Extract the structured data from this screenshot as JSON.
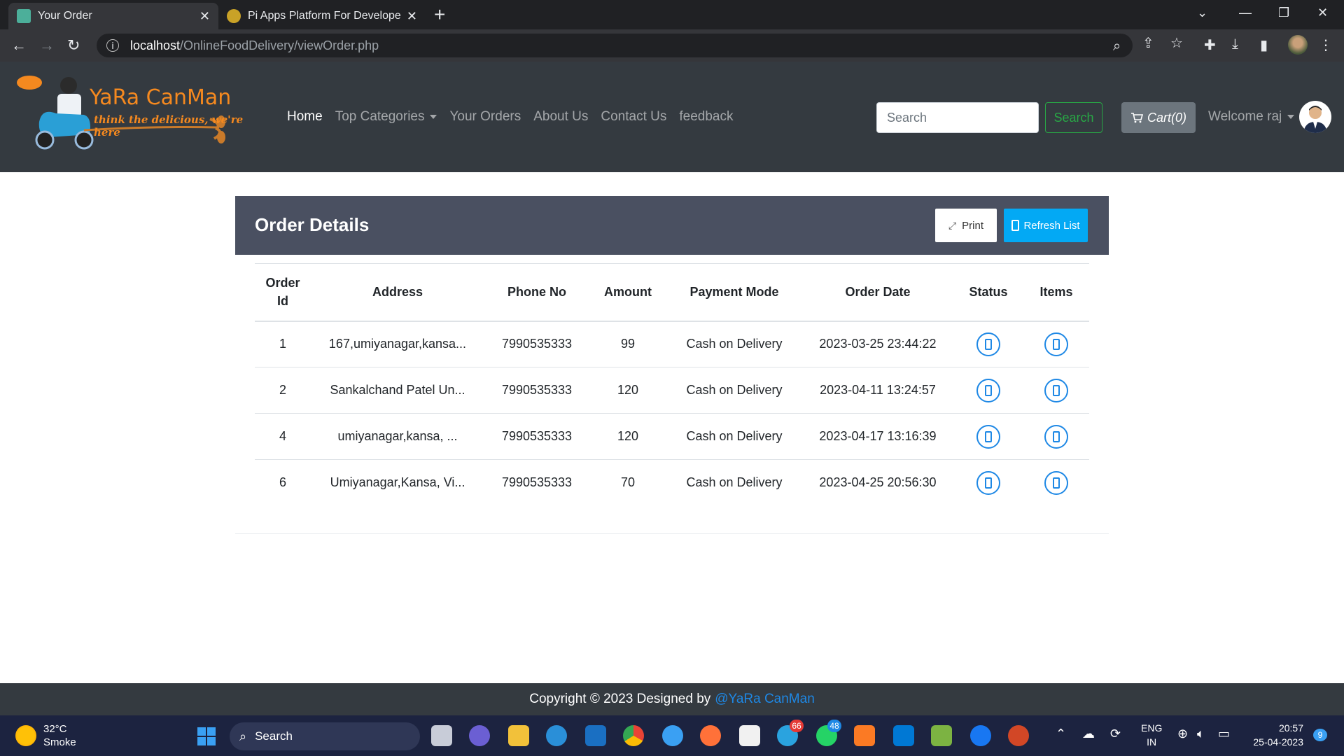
{
  "browser": {
    "tabs": [
      {
        "title": "Your Order",
        "active": true
      },
      {
        "title": "Pi Apps Platform For Developers",
        "active": false
      }
    ],
    "url_host": "localhost",
    "url_path": "/OnlineFoodDelivery/viewOrder.php"
  },
  "site": {
    "brand": "YaRa CanMan",
    "tagline": "think the delicious, we're here",
    "nav": [
      "Home",
      "Top Categories",
      "Your Orders",
      "About Us",
      "Contact Us",
      "feedback"
    ],
    "search_placeholder": "Search",
    "search_button": "Search",
    "cart_label": "Cart(0)",
    "welcome": "Welcome raj"
  },
  "order_panel": {
    "title": "Order Details",
    "print_label": "Print",
    "refresh_label": "Refresh List",
    "headers": [
      "Order Id",
      "Address",
      "Phone No",
      "Amount",
      "Payment Mode",
      "Order Date",
      "Status",
      "Items"
    ],
    "rows": [
      {
        "id": "1",
        "address": "167,umiyanagar,kansa...",
        "phone": "7990535333",
        "amount": "99",
        "payment": "Cash on Delivery",
        "date": "2023-03-25 23:44:22"
      },
      {
        "id": "2",
        "address": "Sankalchand Patel Un...",
        "phone": "7990535333",
        "amount": "120",
        "payment": "Cash on Delivery",
        "date": "2023-04-11 13:24:57"
      },
      {
        "id": "4",
        "address": "umiyanagar,kansa, ...",
        "phone": "7990535333",
        "amount": "120",
        "payment": "Cash on Delivery",
        "date": "2023-04-17 13:16:39"
      },
      {
        "id": "6",
        "address": "Umiyanagar,Kansa, Vi...",
        "phone": "7990535333",
        "amount": "70",
        "payment": "Cash on Delivery",
        "date": "2023-04-25 20:56:30"
      }
    ]
  },
  "footer": {
    "text": "Copyright © 2023 Designed by",
    "link": "@YaRa CanMan"
  },
  "taskbar": {
    "temperature": "32°C",
    "weather": "Smoke",
    "search": "Search",
    "lang_top": "ENG",
    "lang_bottom": "IN",
    "time": "20:57",
    "date": "25-04-2023",
    "notification_count": "9",
    "telegram_badge": "66",
    "whatsapp_badge": "48"
  },
  "colors": {
    "navbar": "#343a40",
    "card_header": "#4a5061",
    "refresh_button": "#03a9f4",
    "search_button": "#28a745",
    "link": "#1e88e5",
    "brand": "#f5891f"
  }
}
